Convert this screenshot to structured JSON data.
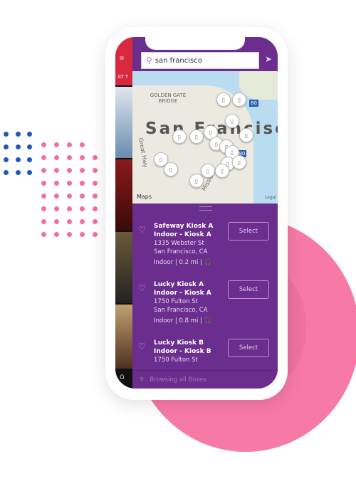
{
  "colors": {
    "accent": "#6b2d8e",
    "pink": "#f77aa6",
    "dots_blue": "#1e5bb8",
    "dots_pink": "#f0709e"
  },
  "search": {
    "value": "san francisco",
    "icon": "search-icon"
  },
  "map": {
    "city_label": "San Francisco",
    "labels": [
      "GOLDEN GATE BRIDGE",
      "Great Hwy",
      "Mission",
      "80",
      "280"
    ],
    "attribution": "Maps",
    "legal": "Legal"
  },
  "side": {
    "label": "AT T"
  },
  "kiosks": [
    {
      "name": "Safeway Kiosk A",
      "subtitle": "Indoor - Kiosk A",
      "street": "1335 Webster St",
      "city": "San Francisco, CA",
      "info": "Indoor | 0.2 mi |",
      "select": "Select"
    },
    {
      "name": "Lucky Kiosk A",
      "subtitle": "Indoor - Kiosk A",
      "street": "1750 Fulton St",
      "city": "San Francisco, CA",
      "info": "Indoor | 0.8 mi |",
      "select": "Select"
    },
    {
      "name": "Lucky Kiosk B",
      "subtitle": "Indoor - Kiosk B",
      "street": "1750 Fulton St",
      "city": "",
      "info": "",
      "select": "Select"
    }
  ],
  "footer": {
    "text": "Browsing all Boxes"
  }
}
